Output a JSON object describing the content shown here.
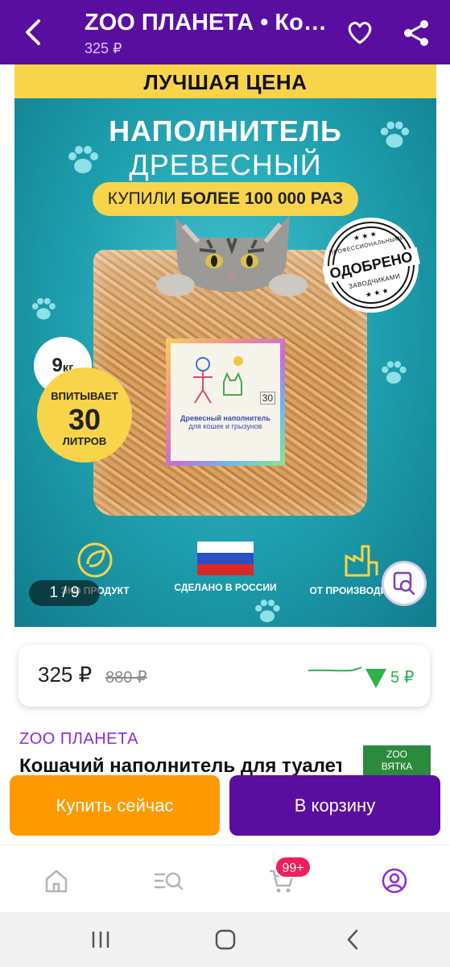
{
  "header": {
    "title": "ZOO ПЛАНЕТА • Кошачий наполнитель для туалета",
    "price": "325 ₽"
  },
  "hero": {
    "best_price": "ЛУЧШАЯ ЦЕНА",
    "headline_1": "НАПОЛНИТЕЛЬ",
    "headline_2": "ДРЕВЕСНЫЙ",
    "bought_prefix": "КУПИЛИ ",
    "bought_bold": "БОЛЕЕ 100 000 РАЗ",
    "approved_top": "ПРОФЕССИОНАЛЬНЫМИ",
    "approved_main": "ОДОБРЕНО",
    "approved_bottom": "ЗАВОДЧИКАМИ",
    "weight": "9",
    "weight_unit": "кг",
    "absorb_1": "ВПИТЫВАЕТ",
    "absorb_2": "30",
    "absorb_3": "ЛИТРОВ",
    "label_text": "Древесный наполнитель",
    "label_sub": "для кошек и грызунов",
    "label_volume": "30",
    "features": [
      {
        "icon": "eco-icon",
        "label": "ЭКО ПРОДУКТ"
      },
      {
        "icon": "russia-flag-icon",
        "label": "СДЕЛАНО В РОССИИ"
      },
      {
        "icon": "factory-icon",
        "label": "ОТ ПРОИЗВОДИТЕЛЯ"
      }
    ],
    "counter": "1 / 9"
  },
  "price_card": {
    "current": "325 ₽",
    "old": "880 ₽",
    "drop": "5 ₽",
    "drop_color": "#2bb24c"
  },
  "product": {
    "brand": "ZOO ПЛАНЕТА",
    "name": "Кошачий наполнитель для туалета",
    "logo_line1": "ZOO",
    "logo_line2": "ВЯТКА"
  },
  "actions": {
    "buy_now": "Купить сейчас",
    "add_to_cart": "В корзину"
  },
  "bottom_nav": {
    "items": [
      "home-icon",
      "catalog-search-icon",
      "cart-icon",
      "profile-icon"
    ],
    "cart_badge": "99+"
  },
  "colors": {
    "brand_purple": "#5a0ea0",
    "buy_orange": "#ff9900",
    "accent_violet": "#8a2bd8"
  }
}
